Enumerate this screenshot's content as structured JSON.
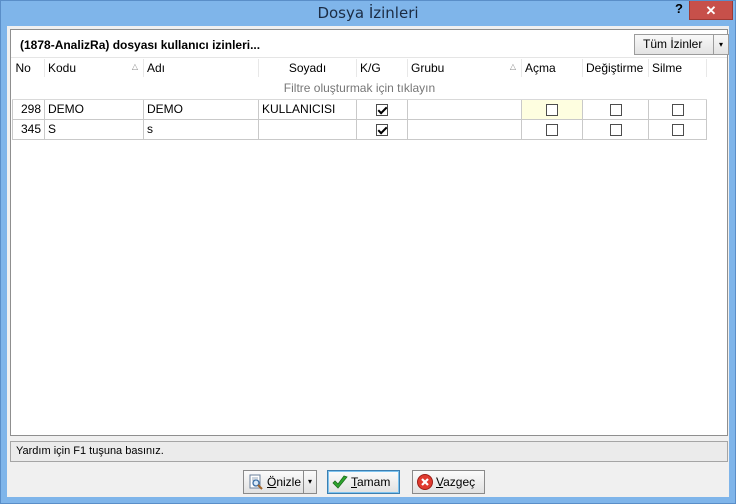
{
  "window": {
    "title": "Dosya İzinleri",
    "help_label": "?",
    "close_label": "✕"
  },
  "panel": {
    "title": "(1878-AnalizRa) dosyası kullanıcı izinleri...",
    "all_permissions_label": "Tüm İzinler",
    "dropdown_arrow": "▾"
  },
  "grid": {
    "columns": [
      "No",
      "Kodu",
      "Adı",
      "Soyadı",
      "K/G",
      "Grubu",
      "Açma",
      "Değiştirme",
      "Silme"
    ],
    "sort_indicator": "△",
    "filter_text": "Filtre oluşturmak için tıklayın",
    "rows": [
      {
        "no": "298",
        "kodu": "DEMO",
        "adi": "DEMO",
        "soyadi": "KULLANICISI",
        "kg": true,
        "grubu": "",
        "acma": false,
        "degistirme": false,
        "silme": false
      },
      {
        "no": "345",
        "kodu": "S",
        "adi": "s",
        "soyadi": "",
        "kg": true,
        "grubu": "",
        "acma": false,
        "degistirme": false,
        "silme": false
      }
    ]
  },
  "status": {
    "text": "Yardım için F1 tuşuna basınız."
  },
  "buttons": {
    "preview_mnemonic": "Ö",
    "preview_rest": "nizle",
    "ok_mnemonic": "T",
    "ok_rest": "amam",
    "cancel_mnemonic": "V",
    "cancel_rest": "azgeç",
    "dropdown_arrow": "▾"
  },
  "icons": {
    "preview": "magnifier-document-icon",
    "ok": "green-check-icon",
    "cancel": "red-x-icon"
  },
  "colors": {
    "titlebar": "#7fb5ea",
    "close": "#c7504a",
    "focus_cell": "#fefee0"
  }
}
